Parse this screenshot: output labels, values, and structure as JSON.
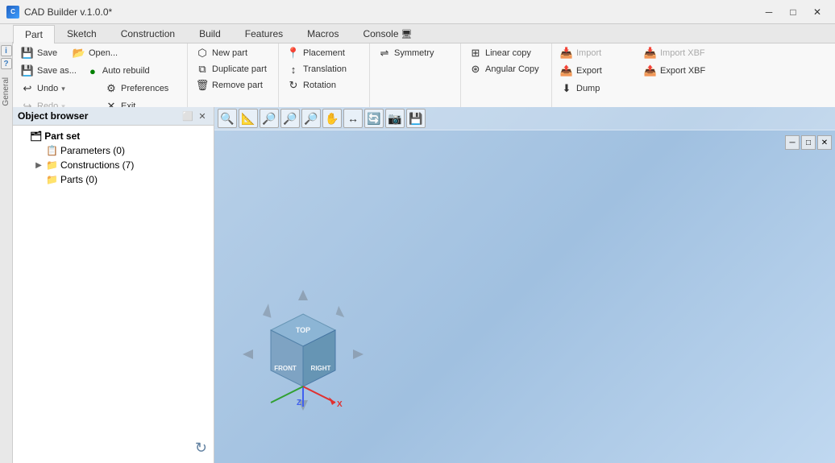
{
  "app": {
    "title": "CAD Builder v.1.0.0*",
    "icon_text": "C"
  },
  "title_controls": {
    "minimize": "─",
    "restore": "□",
    "close": "✕"
  },
  "ribbon": {
    "tabs": [
      {
        "id": "part",
        "label": "Part",
        "active": true
      },
      {
        "id": "sketch",
        "label": "Sketch"
      },
      {
        "id": "construction",
        "label": "Construction"
      },
      {
        "id": "build",
        "label": "Build"
      },
      {
        "id": "features",
        "label": "Features"
      },
      {
        "id": "macros",
        "label": "Macros"
      },
      {
        "id": "console",
        "label": "Console"
      }
    ],
    "groups": {
      "quick": {
        "save": "Save",
        "open": "Open...",
        "save_as": "Save as...",
        "auto_rebuild": "Auto rebuild",
        "undo": "Undo",
        "undo_dropdown": "▾",
        "preferences": "Preferences",
        "redo": "Redo",
        "exit": "Exit"
      },
      "part_group": {
        "new_part": "New part",
        "duplicate_part": "Duplicate part",
        "remove_part": "Remove part"
      },
      "construction_group": {
        "placement": "Placement",
        "translation": "Translation",
        "rotation": "Rotation"
      },
      "symmetry_group": {
        "symmetry": "Symmetry"
      },
      "copy_group": {
        "linear_copy": "Linear copy",
        "angular_copy": "Angular Copy"
      },
      "io_group": {
        "import": "Import",
        "import_xbf": "Import XBF",
        "export": "Export",
        "export_xbf": "Export XBF",
        "dump": "Dump"
      }
    }
  },
  "left_panel": {
    "title": "Object browser",
    "tree": {
      "root": "Part set",
      "nodes": [
        {
          "label": "Parameters (0)",
          "icon": "📋",
          "type": "leaf",
          "indent": 1
        },
        {
          "label": "Constructions (7)",
          "icon": "📁",
          "type": "folder",
          "indent": 1,
          "expanded": true
        },
        {
          "label": "Parts (0)",
          "icon": "📁",
          "type": "folder",
          "indent": 1
        }
      ]
    }
  },
  "viewport": {
    "toolbar_icons": [
      "🔍",
      "📐",
      "🔎",
      "🔎",
      "🔎",
      "✋",
      "↔",
      "🔄",
      "📷",
      "💾"
    ],
    "cube_labels": {
      "top": "TOP",
      "front": "FRONT",
      "right": "RIGHT"
    }
  },
  "general_panel": {
    "label": "General"
  },
  "colors": {
    "accent": "#4080c0",
    "viewport_bg1": "#b8d0e8",
    "viewport_bg2": "#a0c0e0",
    "ribbon_bg": "#f8f8f8",
    "tab_active_bg": "#f8f8f8",
    "panel_header": "#e0e8f0"
  }
}
